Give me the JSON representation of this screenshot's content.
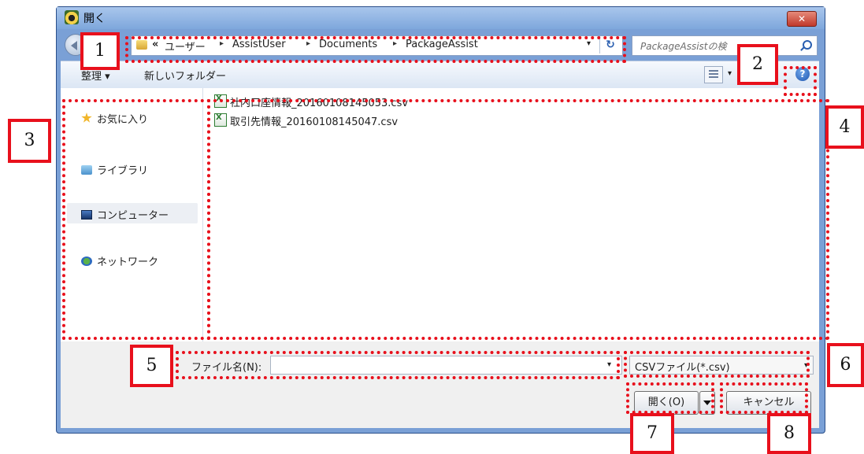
{
  "window": {
    "title": "開く",
    "close_label": "✕"
  },
  "address": {
    "chevron": "«",
    "crumbs": [
      "ユーザー",
      "AssistUser",
      "Documents",
      "PackageAssist"
    ],
    "separator": "▸",
    "dropdown_glyph": "▾",
    "refresh_glyph": "↻"
  },
  "search": {
    "placeholder": "PackageAssistの検"
  },
  "toolbar": {
    "organize_label": "整理 ▾",
    "new_folder_label": "新しいフォルダー",
    "view_dropdown": "▾",
    "help_label": "?"
  },
  "sidebar": {
    "items": [
      {
        "label": "お気に入り",
        "icon": "star-icon"
      },
      {
        "label": "ライブラリ",
        "icon": "library-icon"
      },
      {
        "label": "コンピューター",
        "icon": "computer-icon"
      },
      {
        "label": "ネットワーク",
        "icon": "network-icon"
      }
    ]
  },
  "files": [
    {
      "name": "社内口座情報_20160108145053.csv",
      "icon": "excel-csv-icon"
    },
    {
      "name": "取引先情報_20160108145047.csv",
      "icon": "excel-csv-icon"
    }
  ],
  "footer": {
    "filename_label": "ファイル名(N):",
    "filename_value": "",
    "filename_dropdown": "▾",
    "filetype_value": "CSVファイル(*.csv)",
    "filetype_dropdown": "▾",
    "open_label": "開く(O)",
    "cancel_label": "キャンセル"
  },
  "markers": [
    "1",
    "2",
    "3",
    "4",
    "5",
    "6",
    "7",
    "8"
  ],
  "colors": {
    "annotation": "#e8101c",
    "window_frame": "#7aa0d6"
  }
}
